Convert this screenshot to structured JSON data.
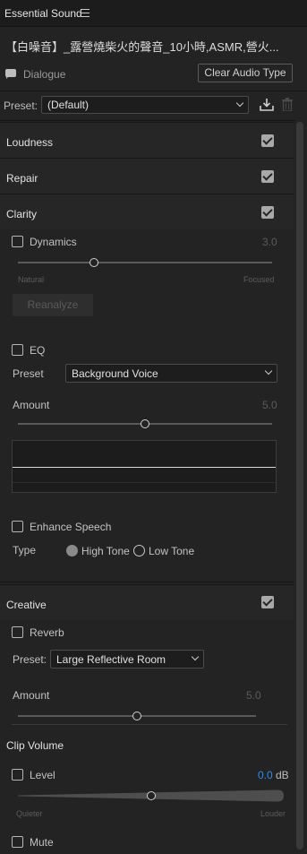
{
  "header": {
    "title": "Essential Sound",
    "menu_icon": "hamburger-menu-icon"
  },
  "clip": {
    "name": "【白噪音】_露營燒柴火的聲音_10小時,ASMR,營火..."
  },
  "type": {
    "label": "Dialogue",
    "clear_button": "Clear Audio Type"
  },
  "preset": {
    "label": "Preset:",
    "value": "(Default)"
  },
  "sections": {
    "loudness": {
      "title": "Loudness",
      "checked": true
    },
    "repair": {
      "title": "Repair",
      "checked": true
    },
    "clarity": {
      "title": "Clarity",
      "checked": true
    },
    "creative": {
      "title": "Creative",
      "checked": true
    }
  },
  "clarity": {
    "dynamics": {
      "label": "Dynamics",
      "value": "3.0",
      "min_label": "Natural",
      "max_label": "Focused",
      "level": 0.3
    },
    "reanalyze_button": "Reanalyze",
    "eq": {
      "label": "EQ",
      "preset_label": "Preset",
      "preset_value": "Background Voice",
      "amount_label": "Amount",
      "amount_value": "5.0",
      "level": 0.5
    },
    "enhance_speech": {
      "label": "Enhance Speech",
      "type_label": "Type",
      "options": [
        "High Tone",
        "Low Tone"
      ],
      "selected": "High Tone"
    }
  },
  "creative": {
    "reverb": {
      "label": "Reverb",
      "preset_label": "Preset:",
      "preset_value": "Large Reflective Room",
      "amount_label": "Amount",
      "amount_value": "5.0",
      "level": 0.5
    }
  },
  "clip_volume": {
    "title": "Clip Volume",
    "level": {
      "label": "Level",
      "value": "0.0",
      "unit": "dB",
      "min_label": "Quieter",
      "max_label": "Louder",
      "position": 0.5
    },
    "mute": {
      "label": "Mute"
    }
  },
  "colors": {
    "accent_blue": "#2d8ceb",
    "panel_bg": "#232323"
  }
}
